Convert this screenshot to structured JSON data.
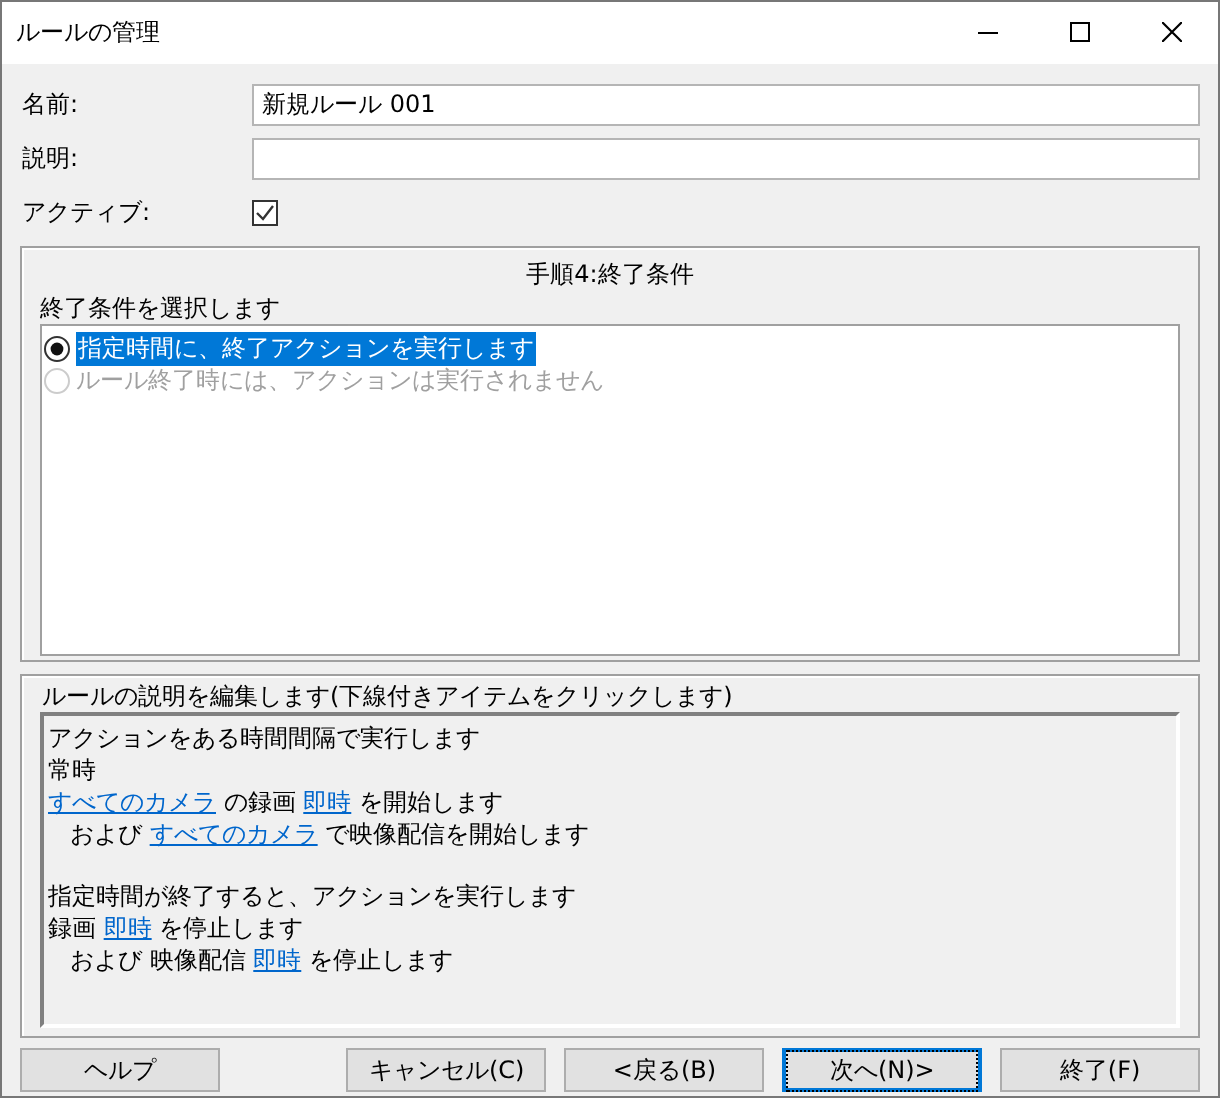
{
  "window": {
    "title": "ルールの管理"
  },
  "fields": [
    {
      "kind": "text",
      "label": "名前:",
      "value": "新規ルール 001"
    },
    {
      "kind": "text",
      "label": "説明:"
    },
    {
      "kind": "checkbox",
      "label": "アクティブ:",
      "checked": true
    }
  ],
  "step_panel": {
    "title": "手順4:終了条件",
    "prompt": "終了条件を選択します",
    "options": [
      {
        "label": "指定時間に、終了アクションを実行します",
        "selected": true,
        "disabled": false
      },
      {
        "label": "ルール終了時には、アクションは実行されません",
        "selected": false,
        "disabled": true
      }
    ]
  },
  "description_panel": {
    "title": "ルールの説明を編集します(下線付きアイテムをクリックします)",
    "blocks": [
      {
        "lines": [
          {
            "kind": "main",
            "segments": [
              {
                "text": "アクションをある時間間隔で実行します",
                "link": false
              }
            ]
          },
          {
            "kind": "main",
            "segments": [
              {
                "text": "常時",
                "link": false
              }
            ]
          },
          {
            "kind": "main",
            "segments": [
              {
                "text": "すべてのカメラ",
                "link": true
              },
              {
                "text": " の録画 ",
                "link": false
              },
              {
                "text": "即時",
                "link": true
              },
              {
                "text": " を開始します",
                "link": false
              }
            ]
          },
          {
            "kind": "sub",
            "segments": [
              {
                "text": "および ",
                "link": false
              },
              {
                "text": "すべてのカメラ",
                "link": true
              },
              {
                "text": " で映像配信を開始します",
                "link": false
              }
            ]
          }
        ]
      },
      {
        "lines": [
          {
            "kind": "main",
            "segments": [
              {
                "text": "指定時間が終了すると、アクションを実行します",
                "link": false
              }
            ]
          },
          {
            "kind": "main",
            "segments": [
              {
                "text": "録画 ",
                "link": false
              },
              {
                "text": "即時",
                "link": true
              },
              {
                "text": " を停止します",
                "link": false
              }
            ]
          },
          {
            "kind": "sub",
            "segments": [
              {
                "text": "および 映像配信 ",
                "link": false
              },
              {
                "text": "即時",
                "link": true
              },
              {
                "text": " を停止します",
                "link": false
              }
            ]
          }
        ]
      }
    ]
  },
  "buttons": [
    {
      "label": "ヘルプ",
      "focused": false
    },
    {
      "label": "キャンセル(C)",
      "focused": false
    },
    {
      "label": "<戻る(B)",
      "focused": false
    },
    {
      "label": "次へ(N)>",
      "focused": true
    },
    {
      "label": "終了(F)",
      "focused": false
    }
  ]
}
